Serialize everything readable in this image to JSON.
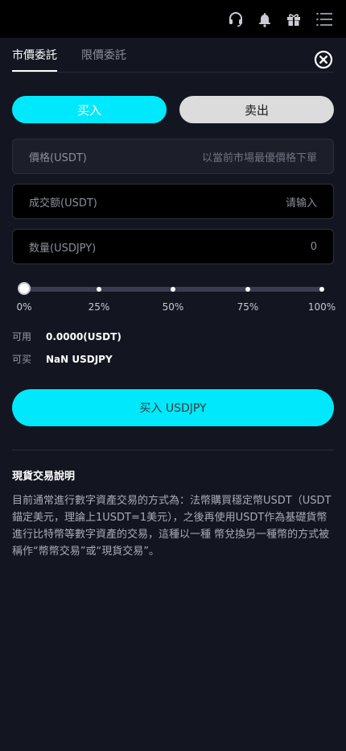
{
  "header": {
    "icons": [
      "headset-icon",
      "bell-icon",
      "gift-icon",
      "menu-icon"
    ]
  },
  "tabs": {
    "market_order": "市價委託",
    "limit_order": "限價委託"
  },
  "side": {
    "buy_label": "买入",
    "sell_label": "卖出"
  },
  "form": {
    "price_label": "價格(USDT)",
    "price_value": "以當前市場最優價格下單",
    "amount_label": "成交额(USDT)",
    "amount_placeholder": "请输入",
    "quantity_label": "数量(USDJPY)",
    "quantity_value": "0"
  },
  "slider": {
    "value_fraction": 0,
    "marks": [
      "0%",
      "25%",
      "50%",
      "75%",
      "100%"
    ]
  },
  "balance": {
    "available_label": "可用",
    "available_value": "0.0000(USDT)",
    "buyable_label": "可买",
    "buyable_value": "NaN USDJPY"
  },
  "submit": {
    "label": "买入 USDJPY"
  },
  "explanation": {
    "title": "現貨交易說明",
    "body": "目前通常進行數字資產交易的方式為：法幣購買穩定幣USDT（USDT錨定美元，理論上1USDT=1美元），之後再使用USDT作為基礎貨幣進行比特幣等數字資產的交易，這種以一種 幣兌換另一種幣的方式被稱作“幣幣交易”或“現貨交易”。"
  },
  "colors": {
    "accent": "#00e8fb",
    "background": "#131620",
    "sell_button": "#dcdcdc"
  }
}
